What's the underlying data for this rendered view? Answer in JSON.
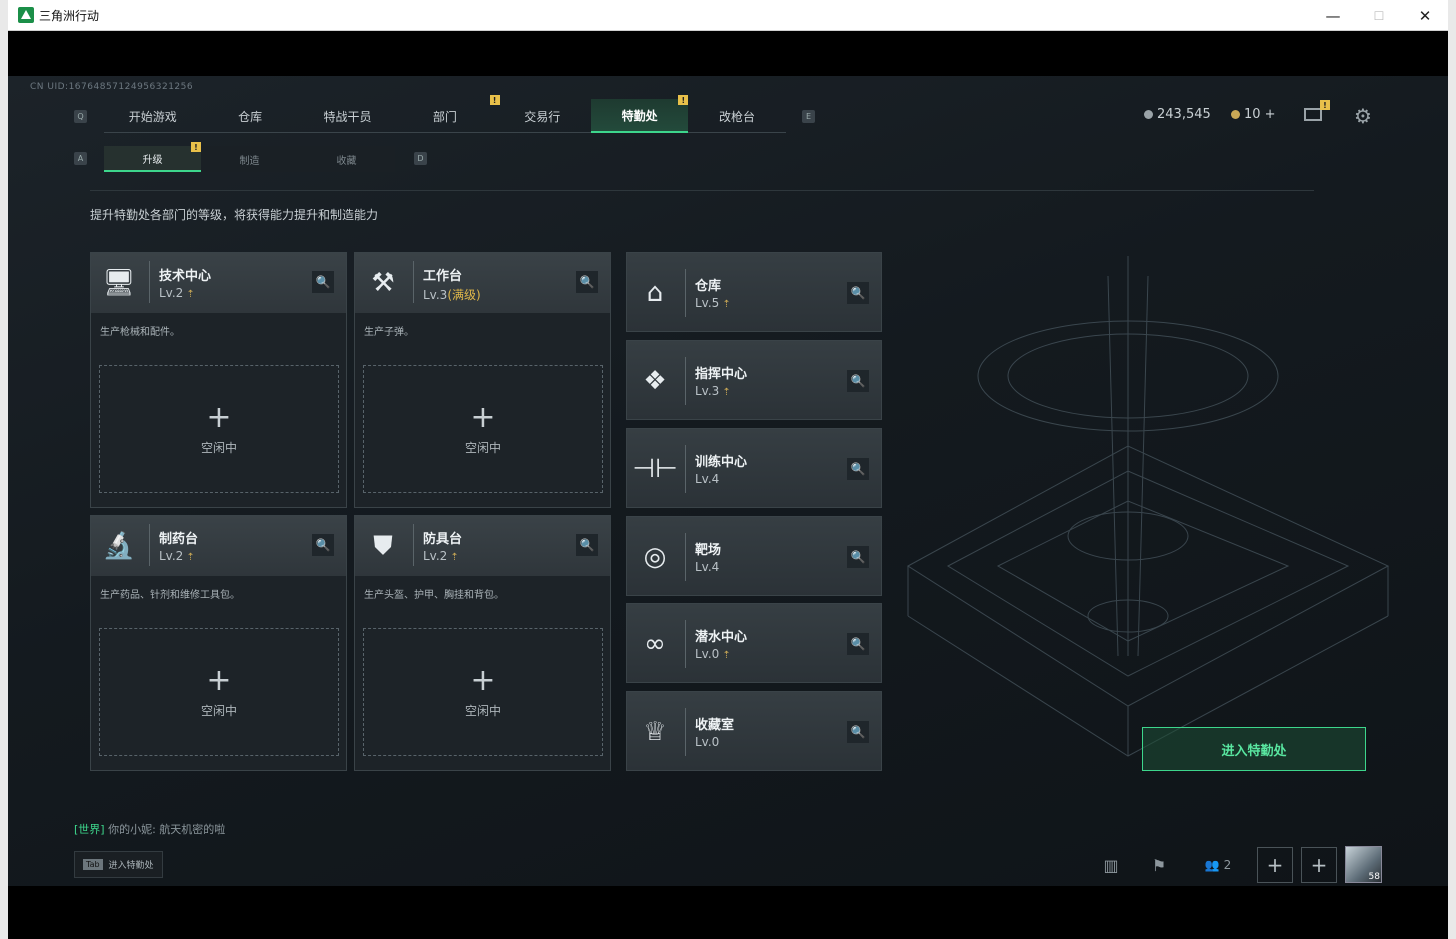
{
  "window": {
    "title": "三角洲行动",
    "minimize": "—",
    "maximize": "☐",
    "close": "✕"
  },
  "uid": "CN UID:16764857124956321256",
  "nav": {
    "left_key": "Q",
    "right_key": "E",
    "tabs": [
      "开始游戏",
      "仓库",
      "特战干员",
      "部门",
      "交易行",
      "特勤处",
      "改枪台"
    ],
    "active": "特勤处",
    "badge": "!"
  },
  "resources": {
    "coins": "243,545",
    "tickets": "10 +"
  },
  "subnav": {
    "left_key": "A",
    "right_key": "D",
    "tabs": [
      "升级",
      "制造",
      "收藏"
    ],
    "active": "升级"
  },
  "description": "提升特勤处各部门的等级，将获得能力提升和制造能力",
  "workshops": [
    {
      "name": "技术中心",
      "level": "Lv.2",
      "max": "",
      "desc": "生产枪械和配件。",
      "status": "空闲中",
      "plus": "+",
      "icon": "computer-icon"
    },
    {
      "name": "工作台",
      "level": "Lv.3",
      "max": "(满级)",
      "desc": "生产子弹。",
      "status": "空闲中",
      "plus": "+",
      "icon": "tools-icon"
    },
    {
      "name": "制药台",
      "level": "Lv.2",
      "max": "",
      "desc": "生产药品、针剂和维修工具包。",
      "status": "空闲中",
      "plus": "+",
      "icon": "microscope-icon"
    },
    {
      "name": "防具台",
      "level": "Lv.2",
      "max": "",
      "desc": "生产头盔、护甲、胸挂和背包。",
      "status": "空闲中",
      "plus": "+",
      "icon": "armor-icon"
    }
  ],
  "facilities": [
    {
      "name": "仓库",
      "level": "Lv.5",
      "icon": "warehouse-icon"
    },
    {
      "name": "指挥中心",
      "level": "Lv.3",
      "icon": "command-icon"
    },
    {
      "name": "训练中心",
      "level": "Lv.4",
      "icon": "dumbbell-icon"
    },
    {
      "name": "靶场",
      "level": "Lv.4",
      "icon": "target-icon"
    },
    {
      "name": "潜水中心",
      "level": "Lv.0",
      "icon": "diving-mask-icon"
    },
    {
      "name": "收藏室",
      "level": "Lv.0",
      "icon": "trophy-icon"
    }
  ],
  "upgrade_arrow": "⇡",
  "search_glyph": "🔍",
  "enter_button": "进入特勤处",
  "chat": {
    "channel": "[世界]",
    "sender": "你的小妮:",
    "message": "航天机密的啦"
  },
  "hint": {
    "key": "Tab",
    "label": "进入特勤处"
  },
  "tray": {
    "friends_count": "2",
    "player_level": "58"
  }
}
